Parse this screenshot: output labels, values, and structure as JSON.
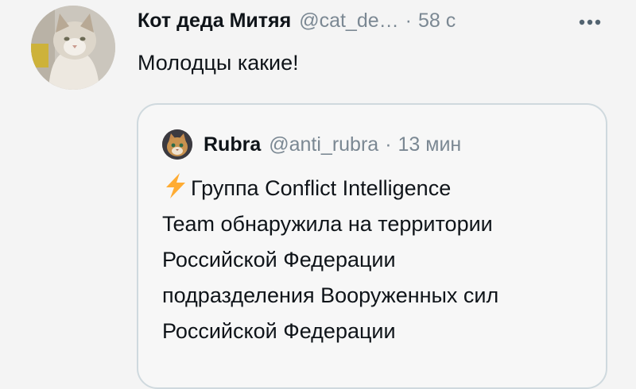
{
  "tweet": {
    "author_name": "Кот деда Митяя",
    "author_handle": "@cat_de…",
    "separator": "·",
    "time": "58 с",
    "text": "Молодцы какие!"
  },
  "icons": {
    "more": "more-horizontal-icon",
    "lightning": "lightning-bolt-emoji"
  },
  "quoted_tweet": {
    "author_name": "Rubra",
    "author_handle": "@anti_rubra",
    "separator": "·",
    "time": "13 мин",
    "lines": [
      "Группа Conflict Intelligence",
      "Team обнаружила на территории",
      "Российской Федерации",
      "подразделения Вооруженных сил",
      "Российской Федерации"
    ]
  },
  "colors": {
    "background": "#f4f4f4",
    "text": "#0f1419",
    "secondary_text": "#7b8893",
    "quote_border": "#cfd9de",
    "lightning": "#ffac33"
  }
}
